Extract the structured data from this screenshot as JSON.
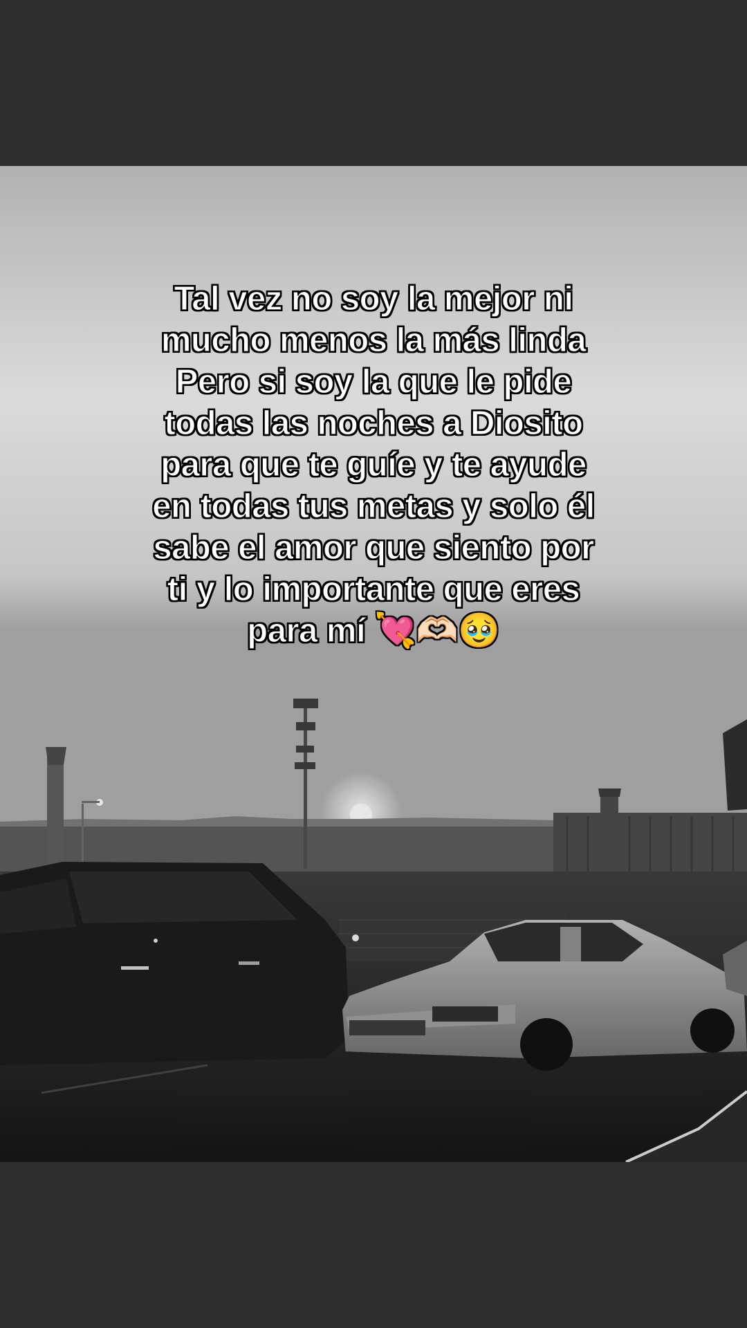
{
  "caption": {
    "lines": [
      "Tal vez no soy la mejor ni",
      "mucho menos la más linda",
      "Pero si soy la que le pide",
      "todas las noches a Diosito",
      "para que te guíe y te ayude",
      "en todas tus metas y solo él",
      "sabe el amor que siento por",
      "ti y lo importante que eres",
      "para mí 💘🫶🏻🥹"
    ]
  },
  "photo": {
    "style": "black-and-white",
    "subject": "parking lot at sunset with cars and light poles"
  }
}
